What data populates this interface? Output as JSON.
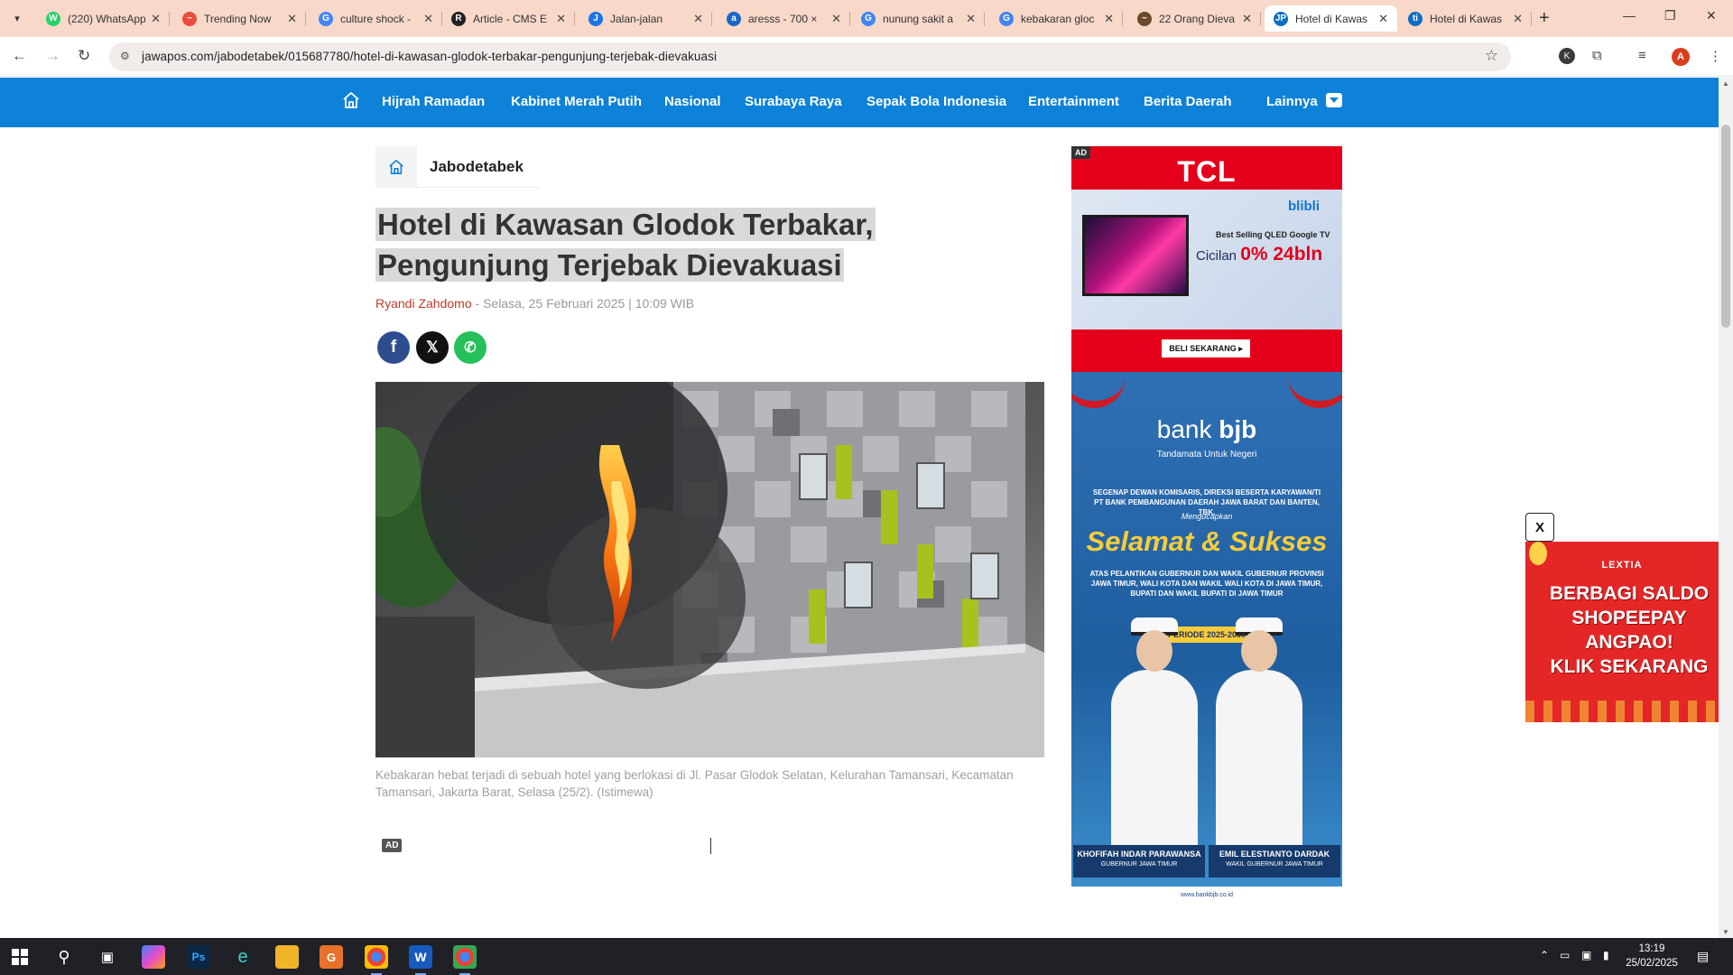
{
  "browser": {
    "tabs": [
      {
        "title": "(220) WhatsApp",
        "color": "#25d366",
        "glyph": "W"
      },
      {
        "title": "Trending Now",
        "color": "#e94b3c",
        "glyph": "~"
      },
      {
        "title": "culture shock -",
        "color": "#4285f4",
        "glyph": "G"
      },
      {
        "title": "Article - CMS E",
        "color": "#222222",
        "glyph": "R"
      },
      {
        "title": "Jalan-jalan",
        "color": "#1a73e8",
        "glyph": "J"
      },
      {
        "title": "aresss - 700 ×",
        "color": "#1b66c9",
        "glyph": "a"
      },
      {
        "title": "nunung sakit a",
        "color": "#4285f4",
        "glyph": "G"
      },
      {
        "title": "kebakaran gloc",
        "color": "#4285f4",
        "glyph": "G"
      },
      {
        "title": "22 Orang Dieva",
        "color": "#6b4a2a",
        "glyph": "~"
      },
      {
        "title": "Hotel di Kawas",
        "color": "#0d6fc4",
        "glyph": "JP"
      },
      {
        "title": "Hotel di Kawas",
        "color": "#0d6fc4",
        "glyph": "ti"
      }
    ],
    "active_tab_index": 9,
    "url": "jawapos.com/jabodetabek/015687780/hotel-di-kawasan-glodok-terbakar-pengunjung-terjebak-dievakuasi",
    "profile_initial": "A",
    "ext_initial": "K"
  },
  "site": {
    "nav": [
      "Hijrah Ramadan",
      "Kabinet Merah Putih",
      "Nasional",
      "Surabaya Raya",
      "Sepak Bola Indonesia",
      "Entertainment",
      "Berita Daerah",
      "Lainnya"
    ],
    "accent": "#0d82d8"
  },
  "article": {
    "breadcrumb": "Jabodetabek",
    "headline_line1": "Hotel di Kawasan Glodok Terbakar,",
    "headline_line2": "Pengunjung Terjebak Dievakuasi",
    "author": "Ryandi Zahdomo",
    "date": "- Selasa, 25 Februari 2025 | 10:09 WIB",
    "caption": "Kebakaran hebat terjadi di sebuah hotel yang berlokasi di Jl. Pasar Glodok Selatan, Kelurahan Tamansari, Kecamatan Tamansari, Jakarta Barat, Selasa (25/2). (Istimewa)",
    "ad_tag": "AD"
  },
  "ads": {
    "corner_tag": "AD",
    "tcl": {
      "brand": "TCL",
      "partner": "blibli",
      "line1": "Best Selling QLED Google TV",
      "line2_prefix": "Cicilan",
      "line2_offer": "0% 24bln",
      "cta": "BELI SEKARANG ▸"
    },
    "bjb": {
      "bank_light": "bank ",
      "bank_bold": "bjb",
      "tagline": "Tandamata Untuk Negeri",
      "intro": "SEGENAP DEWAN KOMISARIS, DIREKSI BESERTA KARYAWAN/TI PT BANK PEMBANGUNAN DAERAH JAWA BARAT DAN BANTEN, TBK.",
      "mengucapkan": "Mengucapkan",
      "headline": "Selamat & Sukses",
      "body": "ATAS PELANTIKAN GUBERNUR DAN WAKIL GUBERNUR PROVINSI JAWA TIMUR, WALI KOTA DAN WAKIL WALI KOTA DI JAWA TIMUR, BUPATI DAN WAKIL BUPATI DI JAWA TIMUR",
      "periode": "PERIODE 2025-2030",
      "person1_name": "KHOFIFAH INDAR PARAWANSA",
      "person1_role": "GUBERNUR JAWA TIMUR",
      "person2_name": "EMIL ELESTIANTO DARDAK",
      "person2_role": "WAKIL GUBERNUR JAWA TIMUR",
      "footer": "www.bankbjb.co.id"
    },
    "float": {
      "close": "X",
      "brand": "LEXTIA",
      "line1": "BERBAGI SALDO",
      "line2": "SHOPEEPAY",
      "line3": "ANGPAO!",
      "line4": "KLIK SEKARANG"
    }
  },
  "taskbar": {
    "time": "13:19",
    "date": "25/02/2025"
  }
}
